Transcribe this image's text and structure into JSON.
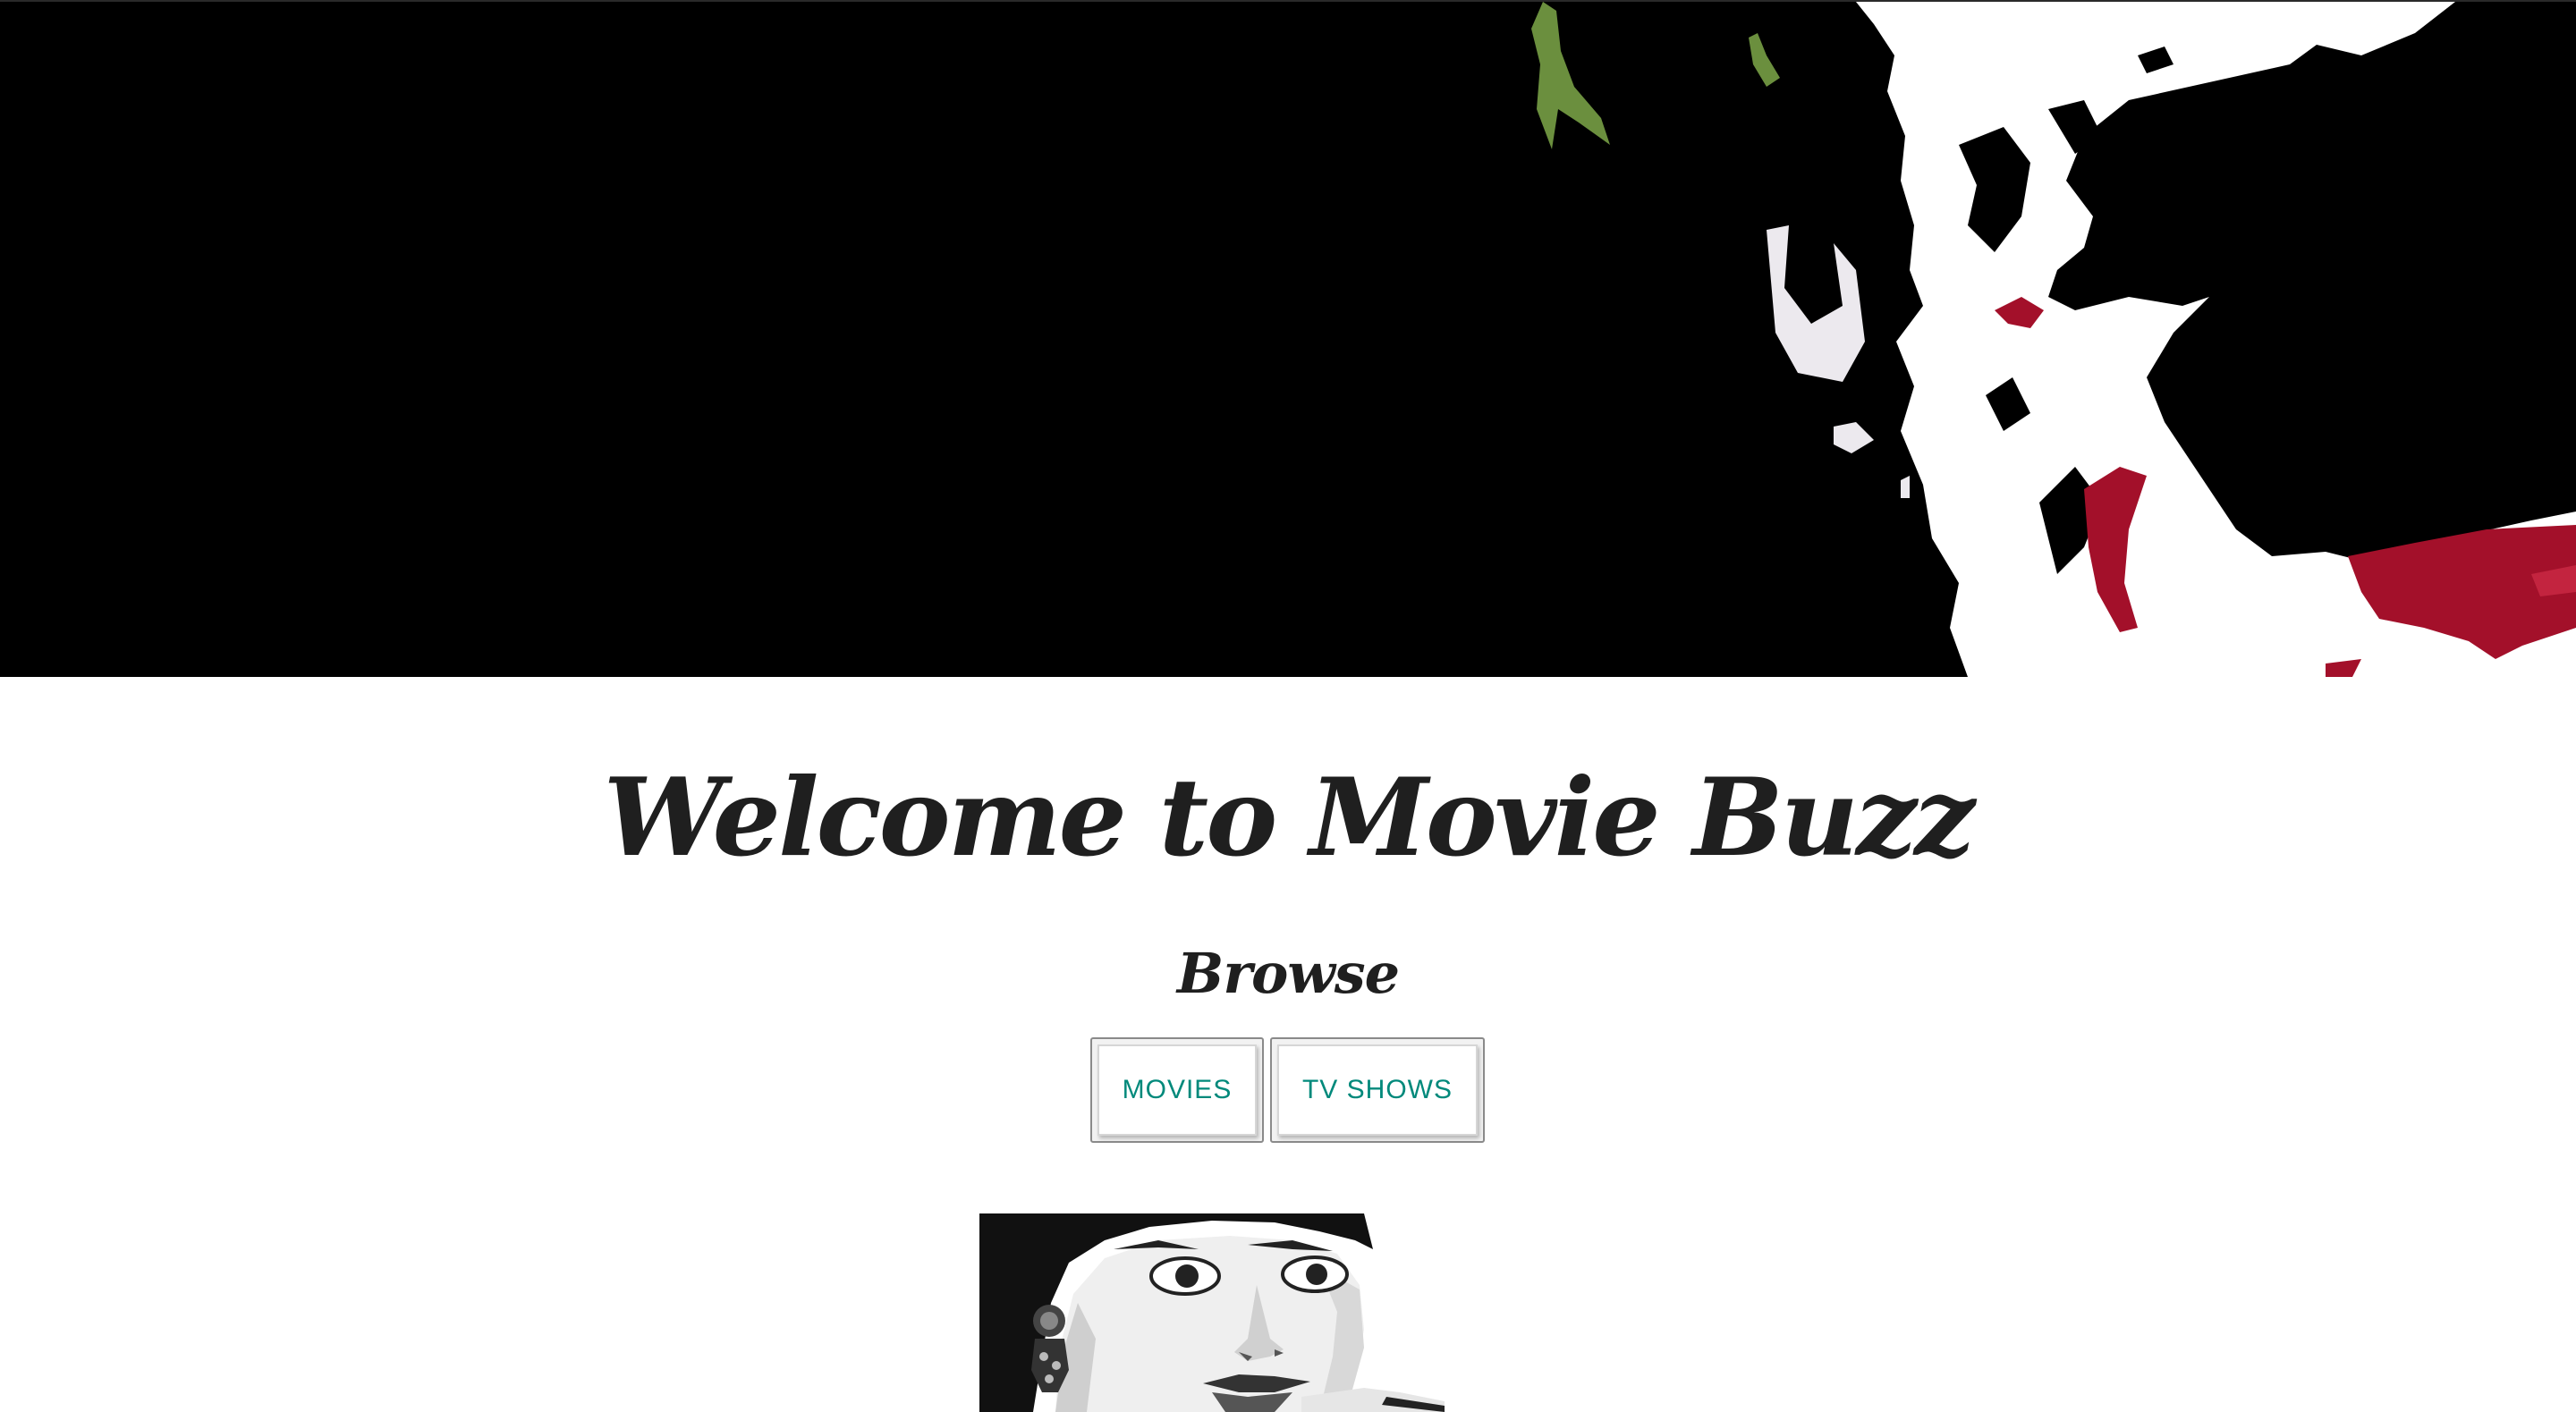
{
  "hero": {
    "image": "joker-pop-art-banner",
    "colors": {
      "background": "#000000",
      "face": "#ffffff",
      "lips": "#a3102a",
      "hair": "#6b8f3e"
    }
  },
  "page": {
    "title": "Welcome to Movie Buzz",
    "subtitle": "Browse"
  },
  "browse": {
    "buttons": [
      {
        "label": "MOVIES"
      },
      {
        "label": "TV SHOWS"
      }
    ],
    "accent": "#00897b"
  },
  "portrait": {
    "image": "audrey-hepburn-portrait"
  }
}
